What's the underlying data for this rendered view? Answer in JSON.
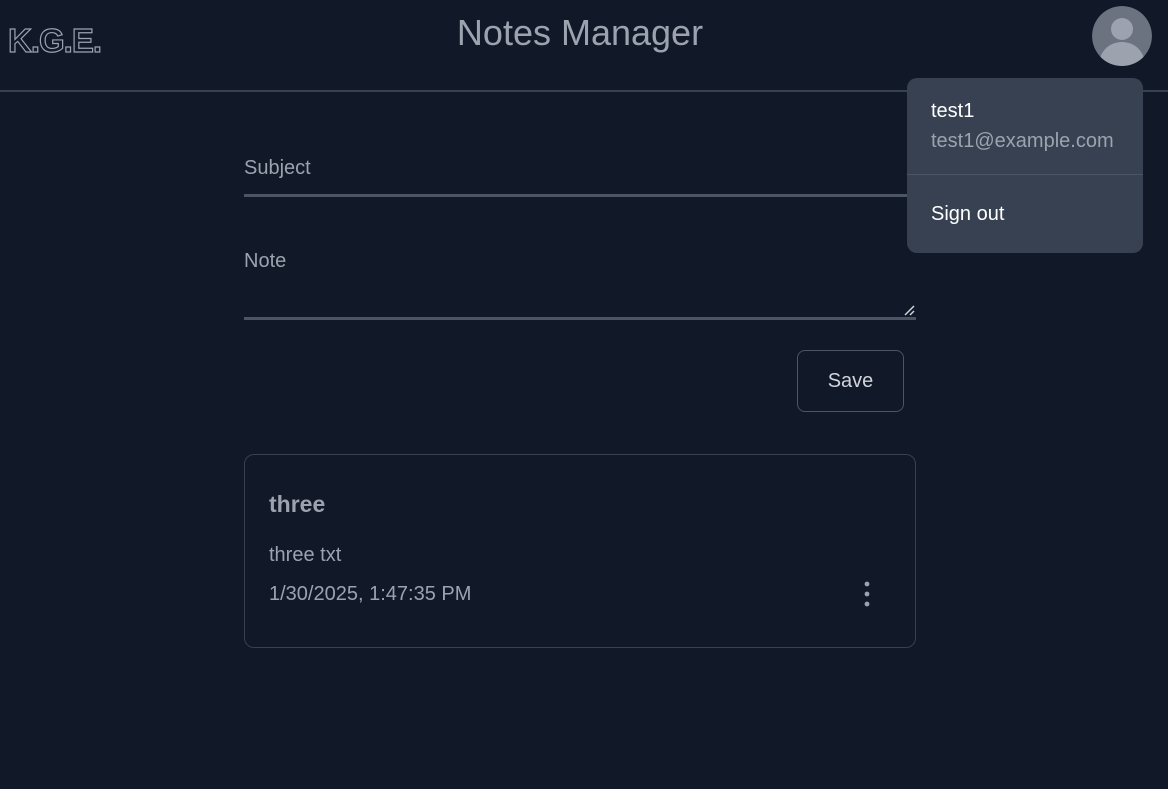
{
  "header": {
    "logo": "K.G.E.",
    "title": "Notes Manager",
    "avatar_icon": "user-avatar-icon"
  },
  "form": {
    "subject_label": "Subject",
    "subject_value": "",
    "note_label": "Note",
    "note_value": "",
    "save_label": "Save"
  },
  "notes": [
    {
      "title": "three",
      "body": "three txt",
      "date": "1/30/2025, 1:47:35 PM",
      "menu_icon": "more-vertical-icon"
    }
  ],
  "user_menu": {
    "username": "test1",
    "email": "test1@example.com",
    "sign_out_label": "Sign out"
  },
  "colors": {
    "background": "#111827",
    "border": "#374151",
    "text_muted": "#9ca3af",
    "menu_bg": "#374151"
  }
}
